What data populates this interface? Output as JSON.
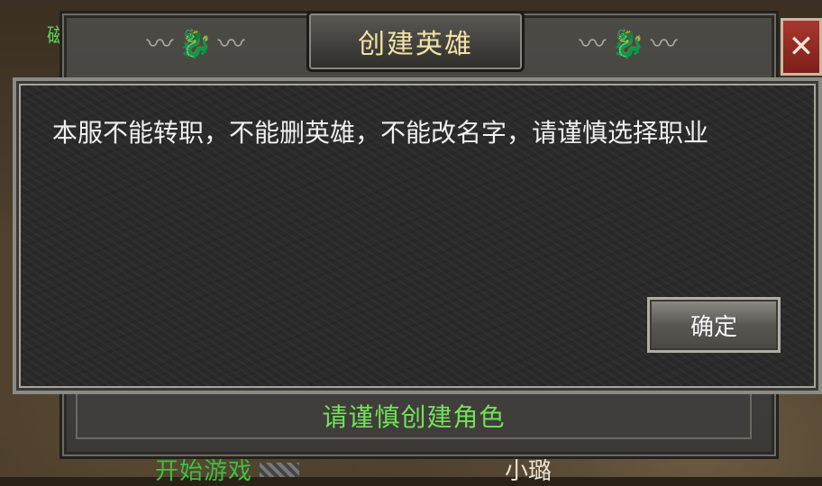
{
  "dialog": {
    "title": "创建英雄",
    "message": "本服不能转职，不能删英雄，不能改名字，请谨慎选择职业",
    "confirm_label": "确定",
    "close_glyph": "✕"
  },
  "footer": {
    "hint": "请谨慎创建角色"
  },
  "background": {
    "left_char": "磁",
    "bottom_left_text": "开始游戏",
    "bottom_right_text": "小璐"
  },
  "icons": {
    "close": "close-icon",
    "dragon_left": "dragon-ornament-icon",
    "dragon_right": "dragon-ornament-icon"
  },
  "colors": {
    "title": "#f2e2a6",
    "footer_hint": "#74e05a",
    "close_bg": "#9a2e26"
  }
}
